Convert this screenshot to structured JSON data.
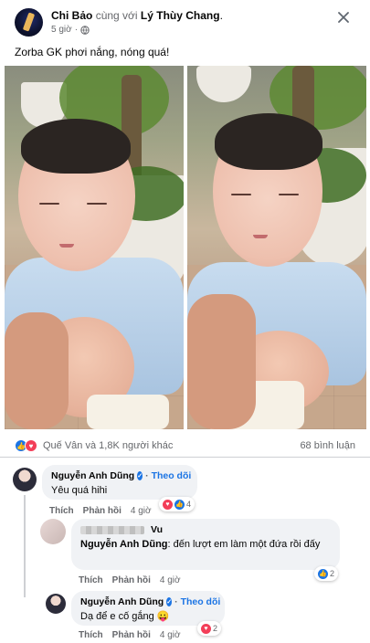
{
  "post": {
    "author": "Chi Bảo",
    "with_text": "cùng với",
    "tagged": "Lý Thùy Chang",
    "time": "5 giờ",
    "separator": "·",
    "caption": "Zorba GK phơi nắng, nóng quá!",
    "close_icon": "close-icon",
    "privacy_icon": "globe-icon"
  },
  "reactions": {
    "summary": "Quế Vân và 1,8K người khác",
    "comments": "68 bình luận",
    "types": [
      "like",
      "love"
    ]
  },
  "comments": [
    {
      "name": "Nguyễn Anh Dũng",
      "verified": true,
      "follow": "Theo dõi",
      "text": "Yêu quá hihi",
      "like": "Thích",
      "reply": "Phản hồi",
      "time": "4 giờ",
      "reaction_count": "4"
    },
    {
      "name": "Vu",
      "mention": "Nguyễn Anh Dũng",
      "text": ": đến lượt em làm một đứa rồi đấy",
      "like": "Thích",
      "reply": "Phản hồi",
      "time": "4 giờ",
      "reaction_count": "2"
    },
    {
      "name": "Nguyễn Anh Dũng",
      "verified": true,
      "follow": "Theo dõi",
      "text": "Dạ để e cố gắng 😛",
      "like": "Thích",
      "reply": "Phản hồi",
      "time": "4 giờ",
      "reaction_count": "2"
    }
  ],
  "colors": {
    "accent": "#1b74e4",
    "love": "#f33e58",
    "secondary_text": "#65676b",
    "bubble": "#f0f2f5"
  }
}
